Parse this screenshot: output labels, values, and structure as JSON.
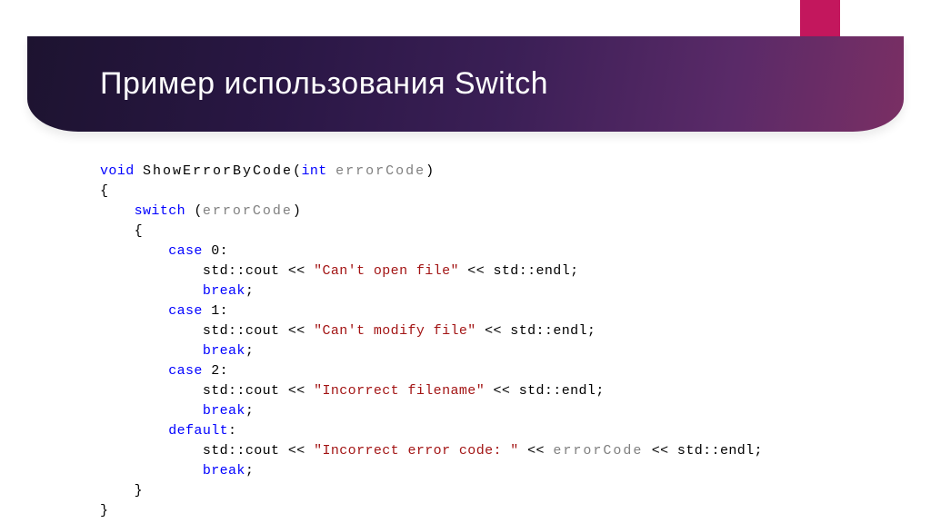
{
  "title": "Пример использования Switch",
  "code": {
    "kw_void": "void",
    "fn_name": "ShowErrorByCode",
    "paren_open": "(",
    "kw_int": "int",
    "param_name": "errorCode",
    "paren_close": ")",
    "brace_open": "{",
    "kw_switch": "switch",
    "sw_arg_open": " (",
    "sw_arg": "errorCode",
    "sw_arg_close": ")",
    "sw_brace_open": "{",
    "kw_case0": "case",
    "case0_val": " 0:",
    "case0_body": "std::cout << ",
    "case0_str": "\"Can't open file\"",
    "case0_end": " << std::endl;",
    "kw_break0": "break",
    "semi0": ";",
    "kw_case1": "case",
    "case1_val": " 1:",
    "case1_body": "std::cout << ",
    "case1_str": "\"Can't modify file\"",
    "case1_end": " << std::endl;",
    "kw_break1": "break",
    "semi1": ";",
    "kw_case2": "case",
    "case2_val": " 2:",
    "case2_body": "std::cout << ",
    "case2_str": "\"Incorrect filename\"",
    "case2_end": " << std::endl;",
    "kw_break2": "break",
    "semi2": ";",
    "kw_default": "default",
    "default_colon": ":",
    "default_body": "std::cout << ",
    "default_str": "\"Incorrect error code: \"",
    "default_mid": " << ",
    "default_var": "errorCode",
    "default_end": " << std::endl;",
    "kw_breakd": "break",
    "semid": ";",
    "sw_brace_close": "}",
    "brace_close": "}"
  }
}
